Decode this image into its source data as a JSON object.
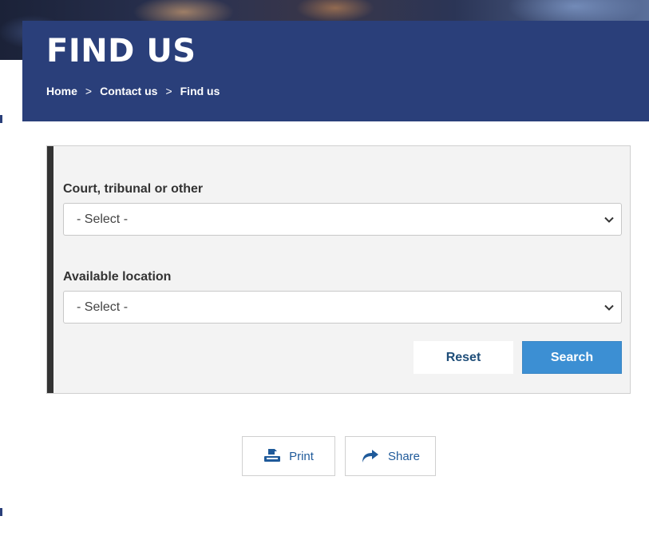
{
  "header": {
    "title": "FIND US",
    "breadcrumb": [
      {
        "label": "Home"
      },
      {
        "label": "Contact us"
      },
      {
        "label": "Find us"
      }
    ],
    "separator": ">"
  },
  "filter": {
    "court_label": "Court, tribunal or other",
    "court_select_value": "- Select -",
    "location_label": "Available location",
    "location_select_value": "- Select -",
    "reset_label": "Reset",
    "search_label": "Search"
  },
  "actions": {
    "print_label": "Print",
    "print_icon": "printer-icon",
    "share_label": "Share",
    "share_icon": "share-arrow-icon"
  },
  "colors": {
    "header_band": "#2a3f7a",
    "search_button": "#3c8fd3",
    "link_text": "#1f5a9a"
  }
}
